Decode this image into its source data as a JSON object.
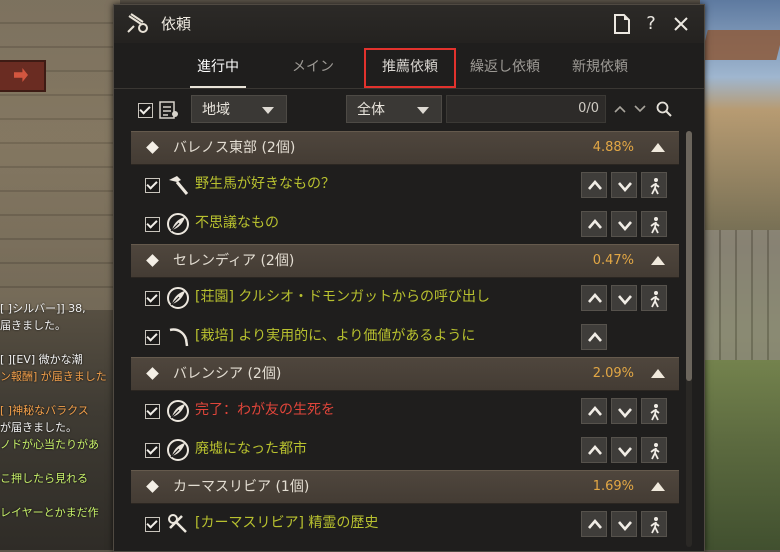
{
  "background": {
    "chat_lines": [
      {
        "text": "[ ]シルバー]] 38,",
        "color": "white"
      },
      {
        "text": "届きました。",
        "color": "white"
      },
      {
        "text": "",
        "color": "white"
      },
      {
        "text": "[ ][EV] 微かな潮",
        "color": "white"
      },
      {
        "text": "ン報酬] が届きました",
        "color": "orange"
      },
      {
        "text": "",
        "color": "white"
      },
      {
        "text": "[ ]神秘なバラクス",
        "color": "orange"
      },
      {
        "text": "が届きました。",
        "color": "white"
      },
      {
        "text": "ノドが心当たりがあ",
        "color": "green"
      },
      {
        "text": "",
        "color": "white"
      },
      {
        "text": "こ押したら見れる",
        "color": "green"
      },
      {
        "text": "",
        "color": "white"
      },
      {
        "text": "レイヤーとかまだ作",
        "color": "green"
      }
    ]
  },
  "window": {
    "title": "依頼",
    "icon": "scroll-icon",
    "buttons": {
      "doc": "document-icon",
      "help": "?",
      "close": "close-icon"
    },
    "tabs": [
      {
        "label": "進行中",
        "active": true,
        "highlight": false
      },
      {
        "label": "メイン",
        "active": false,
        "highlight": false
      },
      {
        "label": "推薦依頼",
        "active": false,
        "highlight": true
      },
      {
        "label": "繰返し依頼",
        "active": false,
        "highlight": false
      },
      {
        "label": "新規依頼",
        "active": false,
        "highlight": false
      }
    ],
    "filter": {
      "region_value": "地域",
      "type_value": "全体",
      "search_count": "0/0"
    },
    "groups": [
      {
        "name": "バレノス東部 (2個)",
        "percent": "4.88%",
        "quests": [
          {
            "title": "野生馬が好きなもの？",
            "icon": "hammer-icon",
            "complete": false,
            "buttons": [
              "up",
              "down",
              "walk"
            ]
          },
          {
            "title": "不思議なもの",
            "icon": "leaf-icon",
            "complete": false,
            "buttons": [
              "up",
              "down",
              "walk"
            ]
          }
        ]
      },
      {
        "name": "セレンディア (2個)",
        "percent": "0.47%",
        "quests": [
          {
            "title": "[荘園] クルシオ・ドモンガットからの呼び出し",
            "icon": "leaf-icon",
            "complete": false,
            "buttons": [
              "up",
              "down",
              "walk"
            ]
          },
          {
            "title": "[栽培] より実用的に、より価値があるように",
            "icon": "sickle-icon",
            "complete": false,
            "buttons": [
              "up"
            ]
          }
        ]
      },
      {
        "name": "バレンシア (2個)",
        "percent": "2.09%",
        "quests": [
          {
            "title": "完了：わが友の生死を",
            "icon": "leaf-icon",
            "complete": true,
            "buttons": [
              "up",
              "down",
              "walk"
            ]
          },
          {
            "title": "廃墟になった都市",
            "icon": "leaf-icon",
            "complete": false,
            "buttons": [
              "up",
              "down",
              "walk"
            ]
          }
        ]
      },
      {
        "name": "カーマスリビア (1個)",
        "percent": "1.69%",
        "quests": [
          {
            "title": "[カーマスリビア] 精霊の歴史",
            "icon": "tools-icon",
            "complete": false,
            "buttons": [
              "up",
              "down",
              "walk"
            ]
          }
        ]
      }
    ]
  },
  "colors": {
    "quest_text": "#b8c12f",
    "complete_text": "#e0453a",
    "percent": "#e2a745",
    "highlight": "#e2322d"
  }
}
